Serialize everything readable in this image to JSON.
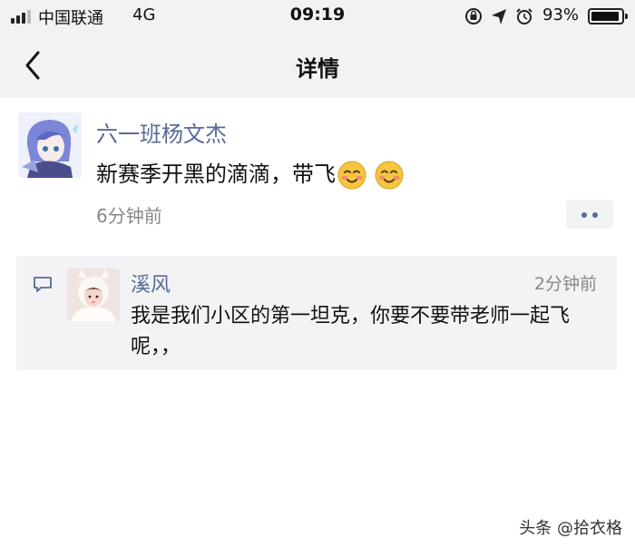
{
  "status_bar": {
    "carrier": "中国联通",
    "network": "4G",
    "time": "09:19",
    "battery_percent": "93%",
    "battery_level": 0.93,
    "icons": [
      "signal-icon",
      "rotation-lock-icon",
      "location-arrow-icon",
      "alarm-icon",
      "battery-icon"
    ]
  },
  "nav": {
    "title": "详情",
    "back_icon": "chevron-left-icon"
  },
  "post": {
    "author": "六一班杨文杰",
    "content": "新赛季开黑的滴滴，带飞",
    "emojis": [
      "blushing-smile-emoji",
      "blushing-smile-emoji"
    ],
    "time": "6分钟前",
    "more_icon": "more-dots-icon"
  },
  "comments": {
    "icon": "comment-icon",
    "items": [
      {
        "author": "溪风",
        "time": "2分钟前",
        "text": "我是我们小区的第一坦克，你要不要带老师一起飞呢，，"
      }
    ]
  },
  "watermark": {
    "text": "头条 @拾衣格"
  },
  "colors": {
    "link_blue": "#576b95",
    "topbar_bg": "#f2f2f2",
    "comment_bg": "#f3f3f5"
  }
}
